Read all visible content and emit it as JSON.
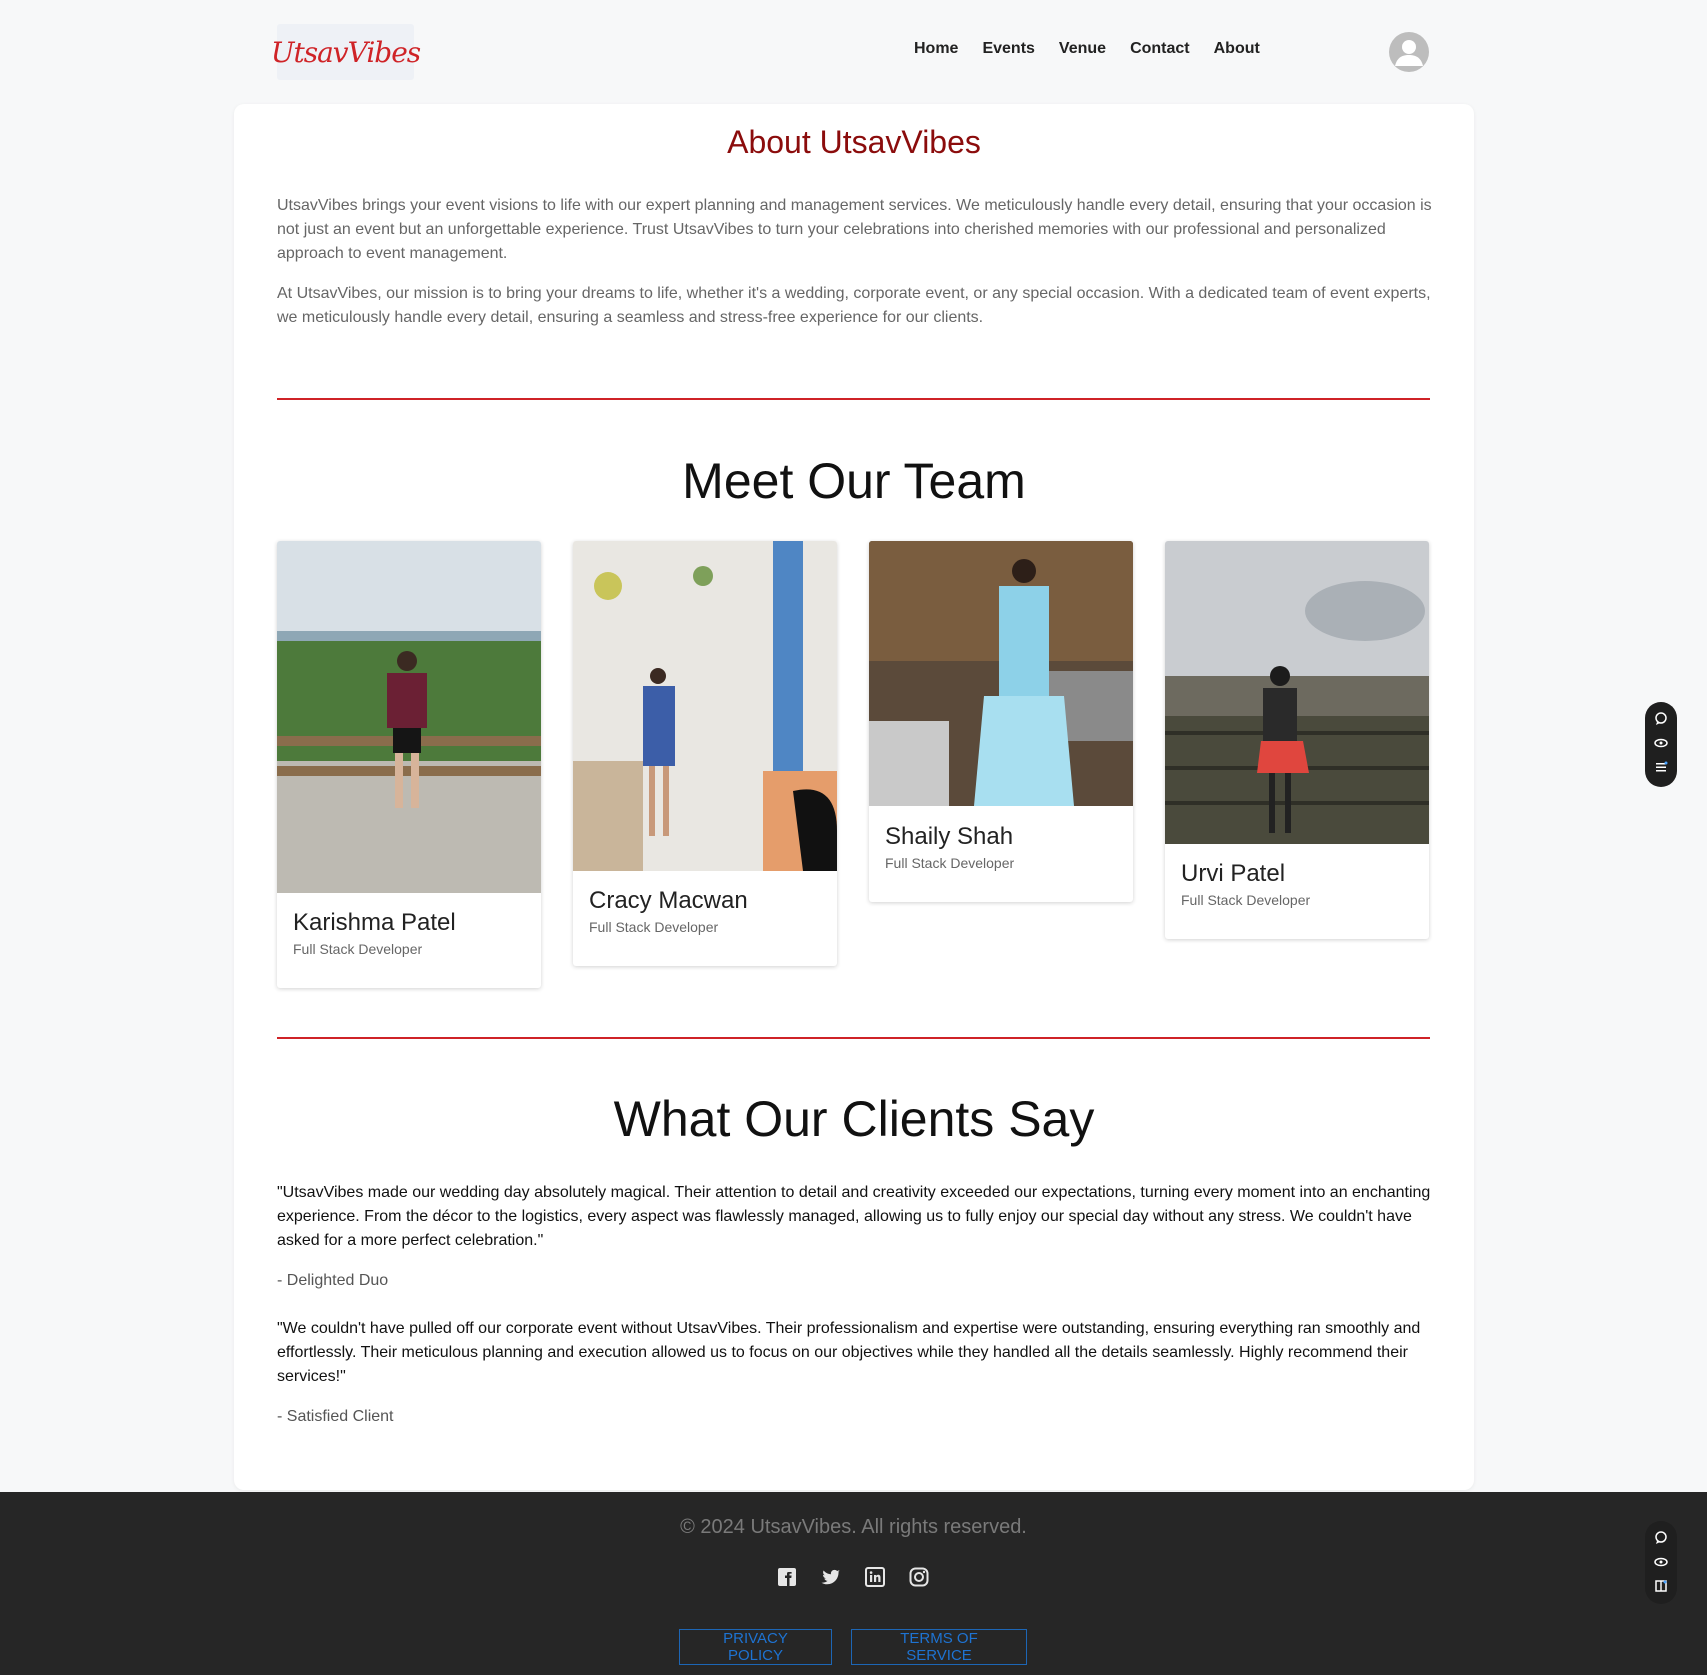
{
  "header": {
    "logo_text": "UtsavVibes",
    "nav": [
      "Home",
      "Events",
      "Venue",
      "Contact",
      "About"
    ]
  },
  "about": {
    "title": "About UtsavVibes",
    "paragraphs": [
      "UtsavVibes brings your event visions to life with our expert planning and management services. We meticulously handle every detail, ensuring that your occasion is not just an event but an unforgettable experience. Trust UtsavVibes to turn your celebrations into cherished memories with our professional and personalized approach to event management.",
      "At UtsavVibes, our mission is to bring your dreams to life, whether it's a wedding, corporate event, or any special occasion. With a dedicated team of event experts, we meticulously handle every detail, ensuring a seamless and stress-free experience for our clients."
    ]
  },
  "team": {
    "title": "Meet Our Team",
    "members": [
      {
        "name": "Karishma Patel",
        "role": "Full Stack Developer"
      },
      {
        "name": "Cracy Macwan",
        "role": "Full Stack Developer"
      },
      {
        "name": "Shaily Shah",
        "role": "Full Stack Developer"
      },
      {
        "name": "Urvi Patel",
        "role": "Full Stack Developer"
      }
    ]
  },
  "testimonials": {
    "title": "What Our Clients Say",
    "items": [
      {
        "quote": "\"UtsavVibes made our wedding day absolutely magical. Their attention to detail and creativity exceeded our expectations, turning every moment into an enchanting experience. From the décor to the logistics, every aspect was flawlessly managed, allowing us to fully enjoy our special day without any stress. We couldn't have asked for a more perfect celebration.\"",
        "author": "- Delighted Duo"
      },
      {
        "quote": "\"We couldn't have pulled off our corporate event without UtsavVibes. Their professionalism and expertise were outstanding, ensuring everything ran smoothly and effortlessly. Their meticulous planning and execution allowed us to focus on our objectives while they handled all the details seamlessly. Highly recommend their services!\"",
        "author": "- Satisfied Client"
      }
    ]
  },
  "footer": {
    "copyright": "© 2024 UtsavVibes. All rights reserved.",
    "socials": [
      "facebook-icon",
      "twitter-icon",
      "linkedin-icon",
      "instagram-icon"
    ],
    "privacy_label": "PRIVACY POLICY",
    "terms_label": "TERMS OF SERVICE"
  },
  "colors": {
    "accent": "#cf2327",
    "about_title": "#8b0c0c",
    "footer_bg": "#262626",
    "link_blue": "#1e73d2"
  }
}
